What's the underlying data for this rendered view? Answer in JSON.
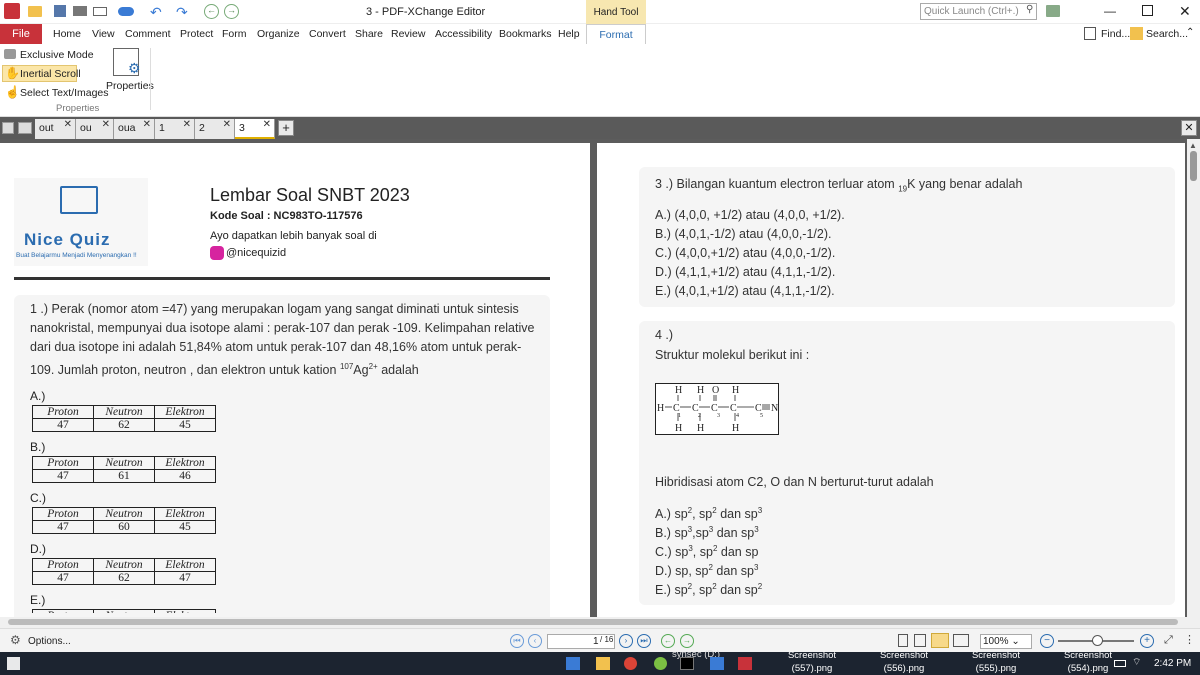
{
  "window": {
    "title": "3 - PDF-XChange Editor",
    "context_tab_group": "Hand Tool",
    "quick_launch_placeholder": "Quick Launch (Ctrl+.)"
  },
  "menu": {
    "file": "File",
    "items": [
      "Home",
      "View",
      "Comment",
      "Protect",
      "Form",
      "Organize",
      "Convert",
      "Share",
      "Review",
      "Accessibility",
      "Bookmarks",
      "Help",
      "Format"
    ],
    "find": "Find...",
    "search": "Search..."
  },
  "ribbon": {
    "exclusive_mode": "Exclusive Mode",
    "inertial_scroll": "Inertial Scroll",
    "select_text": "Select Text/Images",
    "properties": "Properties",
    "group_label": "Properties"
  },
  "tabs": [
    "out",
    "ou",
    "oua",
    "1",
    "2",
    "3"
  ],
  "left_page": {
    "header_title": "Lembar Soal SNBT 2023",
    "header_code": "Kode Soal : NC983TO-117576",
    "header_sub": "Ayo dapatkan lebih banyak soal di",
    "header_handle": "@nicequizid",
    "logo_title": "Nice Quiz",
    "logo_tag": "Buat Belajarmu Menjadi Menyenangkan !!",
    "q1_line1": "1 .) Perak (nomor atom =47) yang merupakan logam yang sangat diminati untuk sintesis",
    "q1_line2": "nanokristal, mempunyai dua isotope alami : perak-107 dan perak -109. Kelimpahan relative",
    "q1_line3": "dari dua isotope ini adalah 51,84% atom untuk perak-107 dan 48,16% atom untuk perak-",
    "q1_line4a": "109. Jumlah proton, neutron , dan elektron untuk kation ",
    "q1_iso": "107",
    "q1_el": "Ag",
    "q1_charge": "2+",
    "q1_line4b": " adalah",
    "col_headers": [
      "Proton",
      "Neutron",
      "Elektron"
    ],
    "options": [
      {
        "label": "A.)",
        "values": [
          "47",
          "62",
          "45"
        ]
      },
      {
        "label": "B.)",
        "values": [
          "47",
          "61",
          "46"
        ]
      },
      {
        "label": "C.)",
        "values": [
          "47",
          "60",
          "45"
        ]
      },
      {
        "label": "D.)",
        "values": [
          "47",
          "62",
          "47"
        ]
      },
      {
        "label": "E.)",
        "values": [
          "",
          "",
          ""
        ]
      }
    ]
  },
  "right_page": {
    "q3_a": "3 .) Bilangan kuantum  electron terluar atom ",
    "q3_sub": "19",
    "q3_b": "K yang benar adalah",
    "q3_options": [
      "A.) (4,0,0, +1/2) atau (4,0,0, +1/2).",
      "B.) (4,0,1,-1/2) atau (4,0,0,-1/2).",
      "C.) (4,0,0,+1/2) atau (4,0,0,-1/2).",
      "D.) (4,1,1,+1/2) atau (4,1,1,-1/2).",
      "E.) (4,0,1,+1/2) atau (4,1,1,-1/2)."
    ],
    "q4_num": "4 .)",
    "q4_text": "Struktur molekul berikut ini :",
    "q4_question": "Hibridisasi atom C2, O dan N berturut-turut adalah",
    "q4_options": [
      {
        "a": "A.) sp",
        "s1": "2",
        "b": ", sp",
        "s2": "2",
        "c": " dan sp",
        "s3": "3"
      },
      {
        "a": "B.) sp",
        "s1": "3",
        "b": ",sp",
        "s2": "3",
        "c": " dan sp",
        "s3": "3"
      },
      {
        "a": "C.) sp",
        "s1": "3",
        "b": ", sp",
        "s2": "2",
        "c": " dan sp",
        "s3": ""
      },
      {
        "a": "D.) sp, sp",
        "s1": "2",
        "b": " dan sp",
        "s2": "3",
        "c": "",
        "s3": ""
      },
      {
        "a": "E.) sp",
        "s1": "2",
        "b": ", sp",
        "s2": "2",
        "c": " dan sp",
        "s3": "2"
      }
    ]
  },
  "status": {
    "options": "Options...",
    "page_current": "1",
    "page_total": "/ 16",
    "zoom": "100%"
  },
  "taskbar": {
    "items": [
      "synsec (D:)",
      "Screenshot (557).png",
      "Screenshot (556).png",
      "Screenshot (555).png",
      "Screenshot (554).png"
    ],
    "time": "2:42 PM"
  },
  "colors": {
    "file_red": "#c8323a",
    "tab_accent": "#e0b000",
    "brand_blue": "#2b6cb0",
    "taskbar": "#1c2430"
  }
}
